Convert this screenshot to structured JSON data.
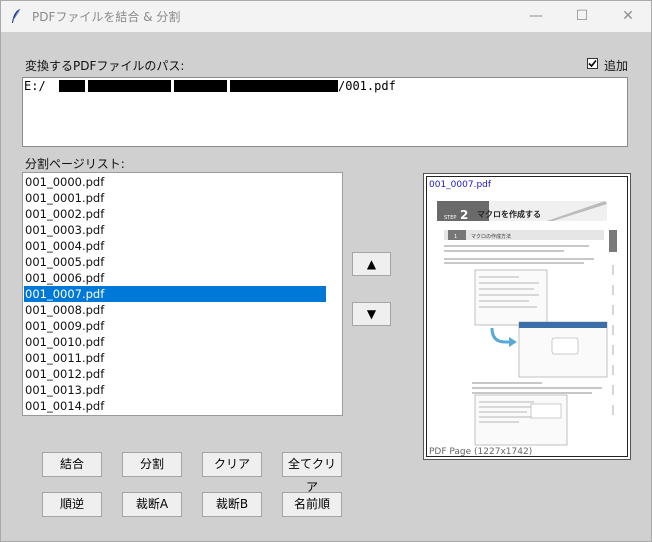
{
  "window": {
    "title": "PDFファイルを結合 & 分割"
  },
  "path_section": {
    "label": "変換するPDFファイルのパス:",
    "prefix": "E:/",
    "suffix": "/001.pdf",
    "append_label": "追加",
    "append_checked": true
  },
  "list_section": {
    "label": "分割ページリスト:",
    "items": [
      "001_0000.pdf",
      "001_0001.pdf",
      "001_0002.pdf",
      "001_0003.pdf",
      "001_0004.pdf",
      "001_0005.pdf",
      "001_0006.pdf",
      "001_0007.pdf",
      "001_0008.pdf",
      "001_0009.pdf",
      "001_0010.pdf",
      "001_0011.pdf",
      "001_0012.pdf",
      "001_0013.pdf",
      "001_0014.pdf"
    ],
    "selected": "001_0007.pdf"
  },
  "move": {
    "up": "▲",
    "down": "▼"
  },
  "preview": {
    "filename": "001_0007.pdf",
    "info": "PDF Page (1227x1742)",
    "page": {
      "step_word": "STEP",
      "step_num": "2",
      "heading": "マクロを作成する",
      "section_num": "1",
      "section_title": "マクロの作成方法"
    }
  },
  "buttons": {
    "row1": [
      "結合",
      "分割",
      "クリア",
      "全てクリア"
    ],
    "row2": [
      "順逆",
      "裁断A",
      "裁断B",
      "名前順"
    ]
  },
  "colors": {
    "selection": "#0078d7",
    "background": "#d0d0d0"
  }
}
